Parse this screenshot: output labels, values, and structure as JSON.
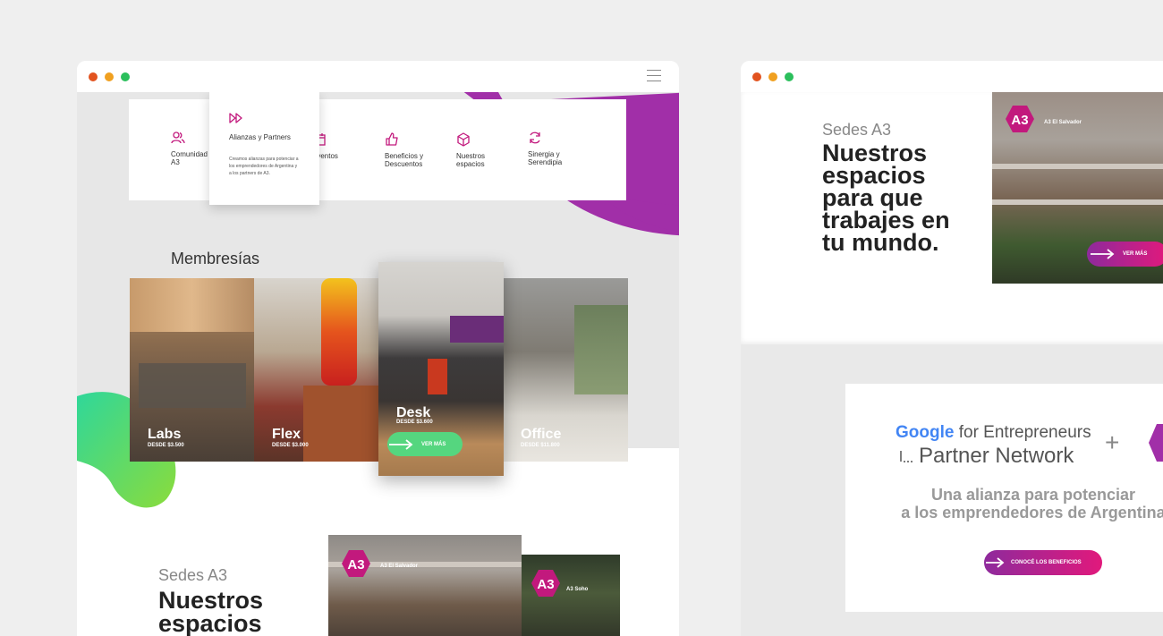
{
  "colors": {
    "accent_magenta": "#c2197d",
    "accent_purple": "#a12fa8",
    "accent_green": "#55d67f",
    "background": "#efefef"
  },
  "left_window": {
    "menu": {
      "items": [
        {
          "label": "Comunidad A3",
          "icon": "people-icon"
        },
        {
          "label": "Eventos",
          "icon": "calendar-icon"
        },
        {
          "label": "Beneficios y Descuentos",
          "icon": "thumbs-up-icon"
        },
        {
          "label": "Nuestros espacios",
          "icon": "cube-icon"
        },
        {
          "label": "Sinergia y Serendipia",
          "icon": "refresh-icon"
        }
      ],
      "dropdown": {
        "icon": "fast-forward-icon",
        "title": "Alianzas y Partners",
        "description": "Creamos alianzas para potenciar a los emprendedores de Argentina y a los partners de A3."
      }
    },
    "membresias_title": "Membresías",
    "tiles": [
      {
        "label": "Labs",
        "price": "DESDE $3.500"
      },
      {
        "label": "Flex",
        "price": "DESDE $3.000"
      },
      {
        "label": "Desk",
        "price": "DESDE $3.600",
        "button": "VER MÁS"
      },
      {
        "label": "Office",
        "price": "DESDE $11.800"
      }
    ],
    "sedes": {
      "kicker": "Sedes A3",
      "heading_line1": "Nuestros",
      "heading_line2": "espacios",
      "locations": [
        {
          "logo": "A3",
          "name": "A3 El Salvador"
        },
        {
          "logo": "A3",
          "name": "A3 Soho"
        }
      ]
    }
  },
  "right_window": {
    "sedes": {
      "kicker": "Sedes A3",
      "heading_lines": [
        "Nuestros",
        "espacios",
        "para que",
        "trabajes en",
        "tu mundo."
      ],
      "location": {
        "logo": "A3",
        "name": "A3 El Salvador"
      },
      "button": "VER MÁS"
    },
    "partner": {
      "google": "Google",
      "for_entrepreneurs": "for Entrepreneurs",
      "partner_network": "Partner Network",
      "plus": "+",
      "tagline_line1": "Una alianza para potenciar",
      "tagline_line2": "a los emprendedores de Argentina",
      "button": "CONOCÉ LOS BENEFICIOS"
    }
  }
}
